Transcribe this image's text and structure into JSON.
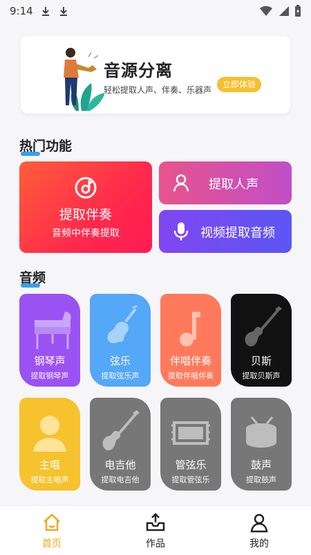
{
  "status": {
    "time": "9:14"
  },
  "banner": {
    "title": "音源分离",
    "subtitle": "轻松提取人声、伴奏、乐器声",
    "button": "立即体验"
  },
  "sections": {
    "hot": "热门功能",
    "audio": "音频"
  },
  "hot": {
    "big": {
      "title": "提取伴奏",
      "subtitle": "音频中伴奏提取"
    },
    "vocal": {
      "label": "提取人声"
    },
    "video": {
      "label": "视频提取音频"
    }
  },
  "cards": [
    {
      "name": "钢琴声",
      "desc": "提取钢琴声",
      "color": "#9b52f2",
      "icon": "piano-icon"
    },
    {
      "name": "弦乐",
      "desc": "提取弦乐声",
      "color": "#55a7f7",
      "icon": "violin-icon"
    },
    {
      "name": "伴唱伴奏",
      "desc": "提取伴唱伴奏",
      "color": "#ff7a5c",
      "icon": "music-note-icon"
    },
    {
      "name": "贝斯",
      "desc": "提取贝斯声",
      "color": "#111111",
      "icon": "bass-guitar-icon"
    },
    {
      "name": "主唱",
      "desc": "提取主唱声",
      "color": "#f6c22e",
      "icon": "singer-icon"
    },
    {
      "name": "电吉他",
      "desc": "提取电吉他",
      "color": "#777777",
      "icon": "electric-guitar-icon"
    },
    {
      "name": "管弦乐",
      "desc": "提取管弦乐",
      "color": "#777777",
      "icon": "film-strip-icon"
    },
    {
      "name": "鼓声",
      "desc": "提取鼓声",
      "color": "#777777",
      "icon": "drum-icon"
    }
  ],
  "tabs": [
    {
      "label": "首页",
      "active": true
    },
    {
      "label": "作品",
      "active": false
    },
    {
      "label": "我的",
      "active": false
    }
  ],
  "colors": {
    "accent": "#f0a818",
    "underline": "#35a0ee"
  }
}
